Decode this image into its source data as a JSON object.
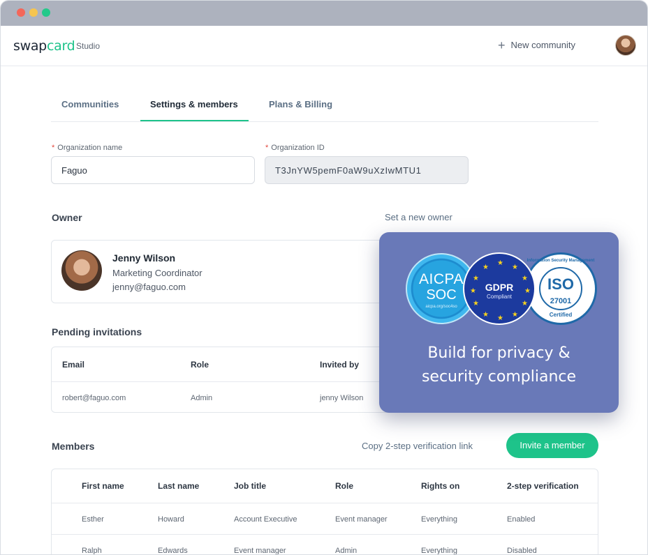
{
  "app": {
    "logo_pre": "swap",
    "logo_accent": "card",
    "product": "Studio",
    "new_community": "New community"
  },
  "tabs": [
    {
      "label": "Communities"
    },
    {
      "label": "Settings & members"
    },
    {
      "label": "Plans & Billing"
    }
  ],
  "form": {
    "required_mark": "*",
    "org_name_label": "Organization name",
    "org_name_value": "Faguo",
    "org_id_label": "Organization ID",
    "org_id_value": "T3JnYW5pemF0aW9uXzIwMTU1"
  },
  "owner": {
    "section_title": "Owner",
    "set_new_owner": "Set a new owner",
    "name": "Jenny Wilson",
    "role": "Marketing Coordinator",
    "email": "jenny@faguo.com"
  },
  "pending": {
    "section_title": "Pending invitations",
    "headers": [
      "Email",
      "Role",
      "Invited by"
    ],
    "rows": [
      {
        "email": "robert@faguo.com",
        "role": "Admin",
        "invited_by": "jenny Wilson"
      }
    ]
  },
  "members": {
    "section_title": "Members",
    "copy_link": "Copy 2-step verification link",
    "invite_button": "Invite a member",
    "headers": [
      "First name",
      "Last name",
      "Job title",
      "Role",
      "Rights on",
      "2-step verification"
    ],
    "rows": [
      {
        "first": "Esther",
        "last": "Howard",
        "job": "Account Executive",
        "role": "Event manager",
        "rights": "Everything",
        "verification": "Enabled"
      },
      {
        "first": "Ralph",
        "last": "Edwards",
        "job": "Event manager",
        "role": "Admin",
        "rights": "Everything",
        "verification": "Disabled"
      }
    ]
  },
  "promo": {
    "line1": "Build for privacy &",
    "line2": "security compliance",
    "badges": {
      "aicpa": {
        "line1": "AICPA",
        "line2": "SOC",
        "line3": "aicpa.org/soc4so"
      },
      "gdpr": {
        "line1": "GDPR",
        "line2": "Compliant"
      },
      "iso": {
        "top": "Information Security Management",
        "line1": "ISO",
        "line2": "27001",
        "line3": "Certified"
      }
    }
  },
  "colors": {
    "accent": "#1ec38a",
    "promo_bg": "#6979b8",
    "titlebar": "#adb2be"
  }
}
